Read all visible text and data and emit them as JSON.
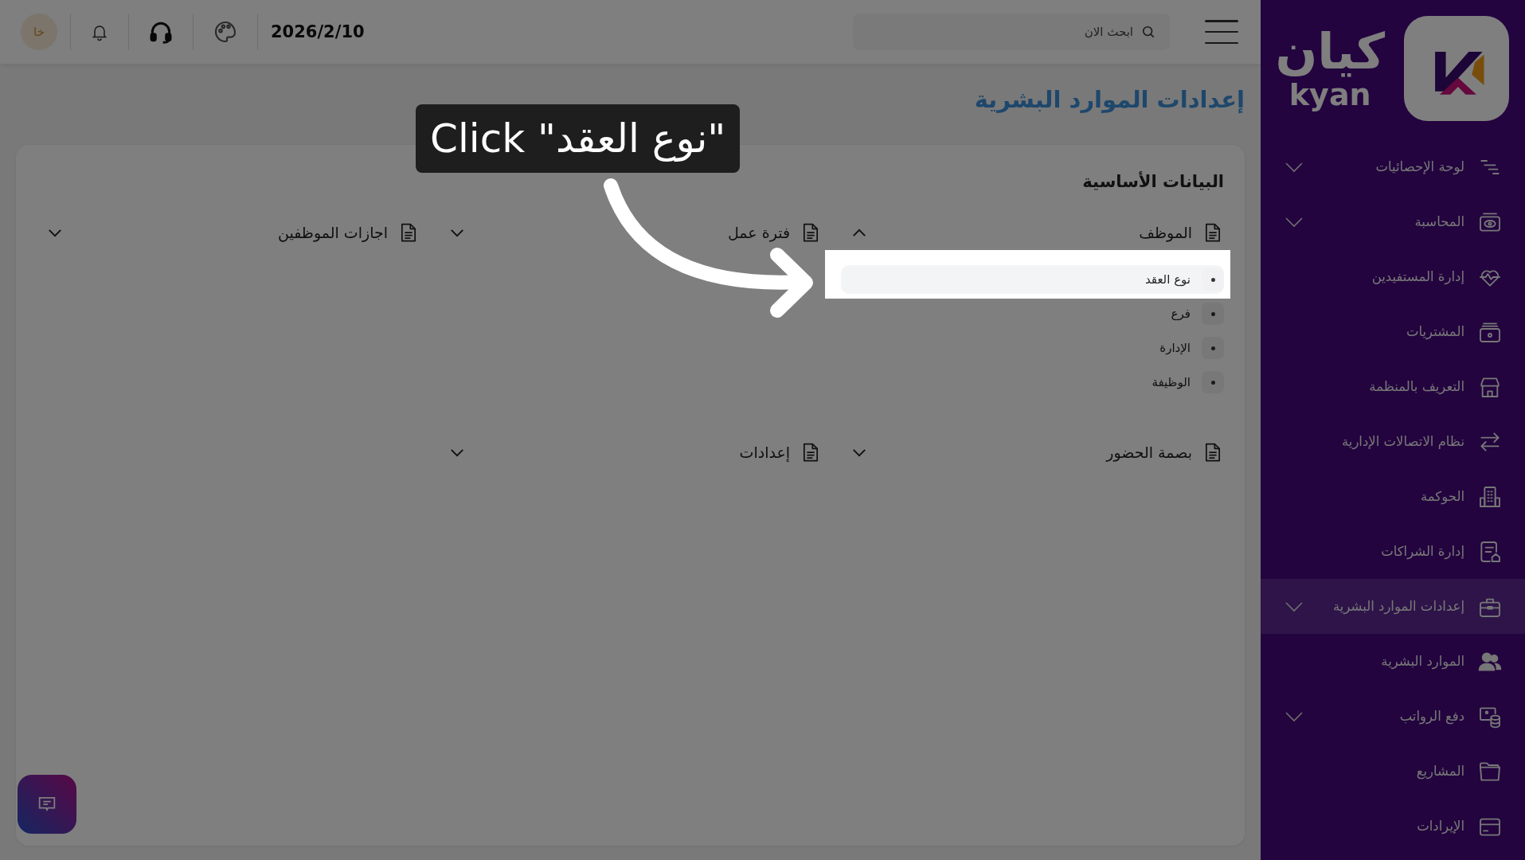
{
  "topbar": {
    "date": "2026/2/10",
    "avatar_initials": "خا",
    "search": {
      "placeholder": "ابحث الان"
    }
  },
  "sidebar": {
    "logo": {
      "arabic": "كيان",
      "latin": "kyan"
    },
    "items": [
      {
        "label": "لوحة الإحصائيات",
        "selected": false,
        "has_submenu": true
      },
      {
        "label": "المحاسبة",
        "selected": false,
        "has_submenu": true
      },
      {
        "label": "إدارة المستفيدين",
        "selected": false,
        "has_submenu": false
      },
      {
        "label": "المشتريات",
        "selected": false,
        "has_submenu": false
      },
      {
        "label": "التعريف بالمنظمة",
        "selected": false,
        "has_submenu": false
      },
      {
        "label": "نظام الاتصالات الإدارية",
        "selected": false,
        "has_submenu": false
      },
      {
        "label": "الحوكمة",
        "selected": false,
        "has_submenu": false
      },
      {
        "label": "إدارة الشراكات",
        "selected": false,
        "has_submenu": false
      },
      {
        "label": "إعدادات الموارد البشرية",
        "selected": true,
        "has_submenu": true
      },
      {
        "label": "الموارد البشرية",
        "selected": false,
        "has_submenu": false
      },
      {
        "label": "دفع الرواتب",
        "selected": false,
        "has_submenu": true
      },
      {
        "label": "المشاريع",
        "selected": false,
        "has_submenu": false
      },
      {
        "label": "الإيرادات",
        "selected": false,
        "has_submenu": false
      }
    ]
  },
  "page_title": "إعدادات الموارد البشرية",
  "card": {
    "title": "البيانات الأساسية",
    "sections": [
      {
        "title": "الموظف",
        "expanded": true,
        "items": [
          {
            "label": "نوع العقد",
            "highlighted": true
          },
          {
            "label": "فرع",
            "highlighted": false
          },
          {
            "label": "الإدارة",
            "highlighted": false
          },
          {
            "label": "الوظيفة",
            "highlighted": false
          }
        ]
      },
      {
        "title": "فترة عمل",
        "expanded": false
      },
      {
        "title": "اجازات الموظفين",
        "expanded": false
      },
      {
        "title": "بصمة الحضور",
        "expanded": false
      },
      {
        "title": "إعدادات",
        "expanded": false
      }
    ]
  },
  "tutorial": {
    "tooltip": "Click \"نوع العقد\""
  }
}
